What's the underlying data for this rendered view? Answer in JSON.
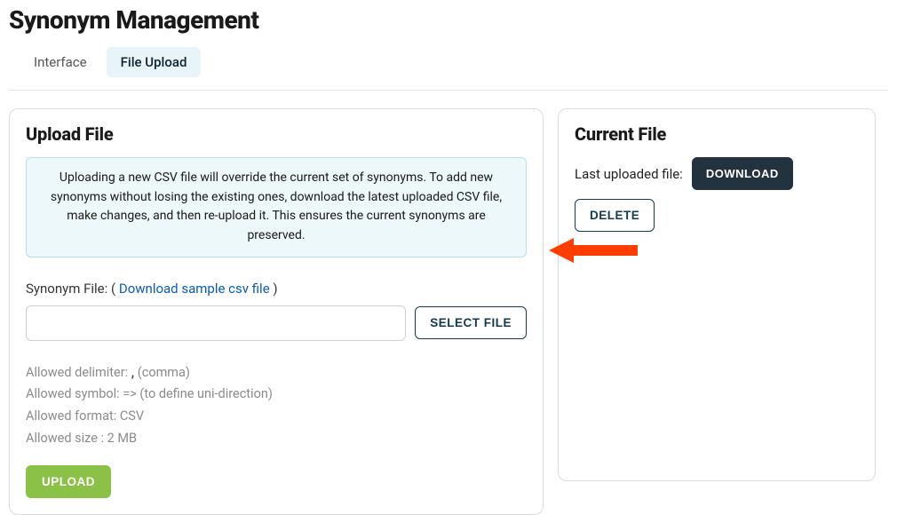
{
  "page_title": "Synonym Management",
  "tabs": [
    {
      "label": "Interface",
      "active": false
    },
    {
      "label": "File Upload",
      "active": true
    }
  ],
  "upload_card": {
    "title": "Upload File",
    "info": "Uploading a new CSV file will override the current set of synonyms. To add new synonyms without losing the existing ones, download the latest uploaded CSV file, make changes, and then re-upload it. This ensures the current synonyms are preserved.",
    "synonym_file_label": "Synonym File: ( ",
    "download_sample_link": "Download sample csv file",
    "synonym_file_label_end": " )",
    "file_input_value": "",
    "select_file_btn": "SELECT FILE",
    "hint_delimiter_prefix": "Allowed delimiter: ",
    "hint_delimiter_symbol": ",",
    "hint_delimiter_suffix": " (comma)",
    "hint_symbol": "Allowed symbol: => (to define uni-direction)",
    "hint_format": "Allowed format: CSV",
    "hint_size": "Allowed size : 2 MB",
    "upload_btn": "UPLOAD"
  },
  "current_card": {
    "title": "Current File",
    "last_uploaded_label": "Last uploaded file:",
    "download_btn": "DOWNLOAD",
    "delete_btn": "DELETE"
  },
  "annotation": {
    "arrow_color": "#ff3d00"
  }
}
